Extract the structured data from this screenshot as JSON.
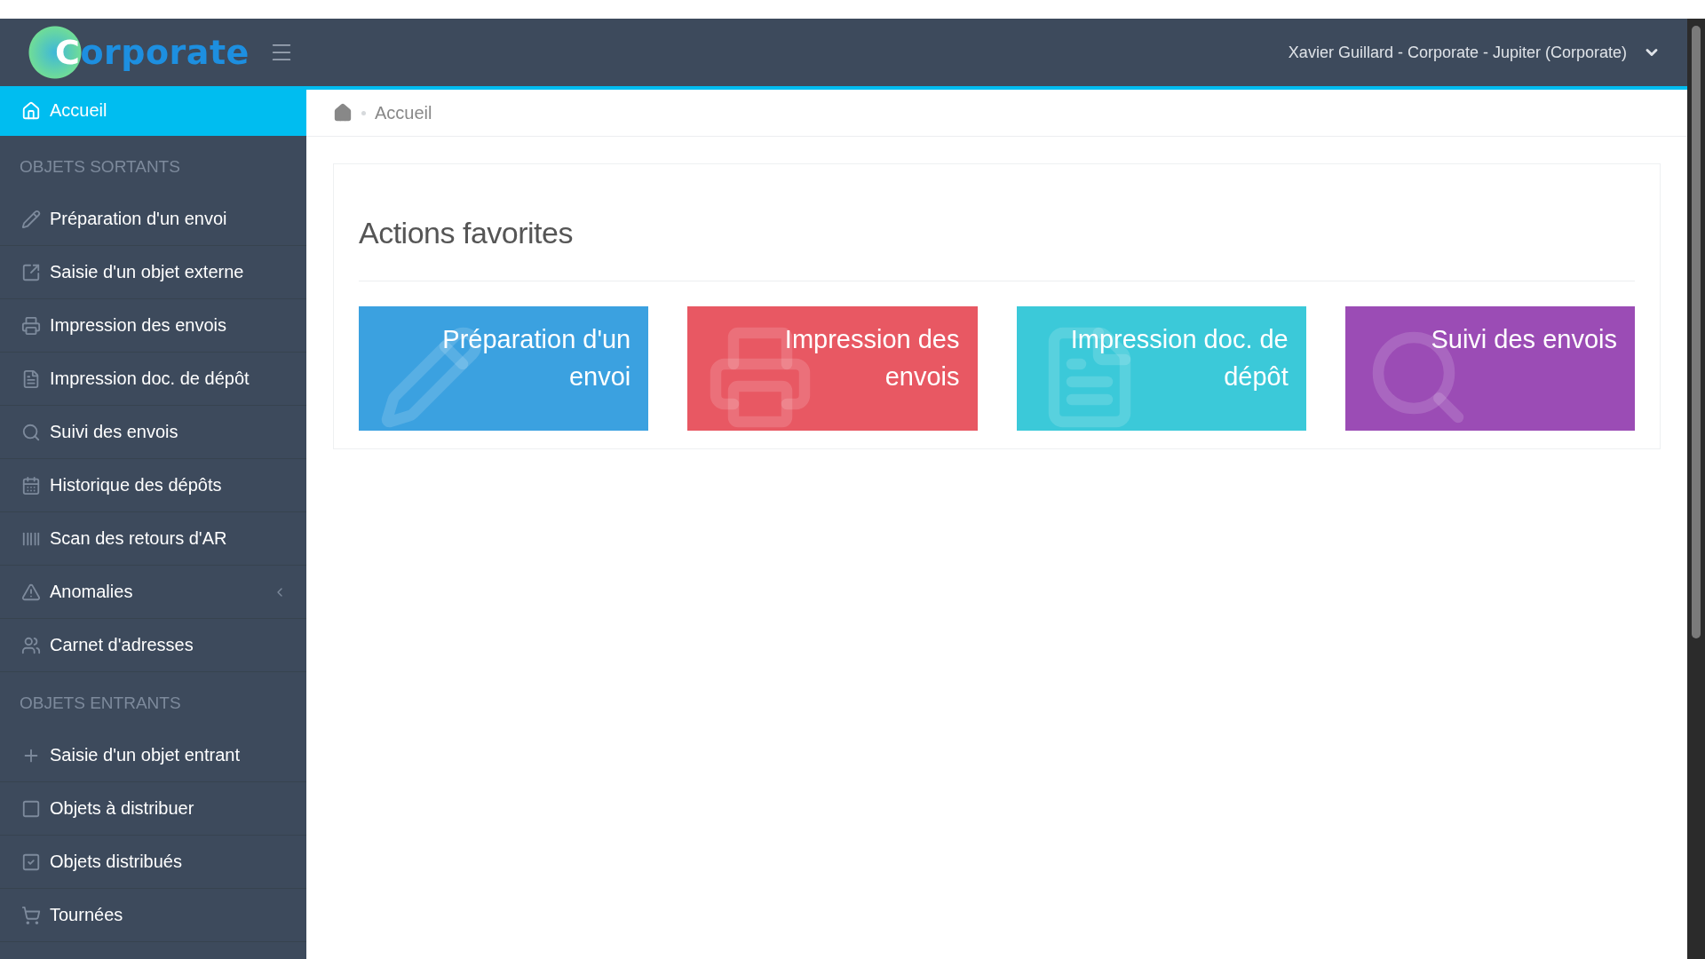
{
  "header": {
    "logo": "Corporate",
    "user": "Xavier Guillard - Corporate - Jupiter (Corporate)"
  },
  "sidebar": {
    "items": [
      {
        "kind": "link",
        "label": "Accueil",
        "selected": true
      },
      {
        "kind": "header",
        "label": "OBJETS SORTANTS"
      },
      {
        "kind": "link",
        "label": "Préparation d'un envoi",
        "selected": false
      },
      {
        "kind": "link",
        "label": "Saisie d'un objet externe",
        "selected": false
      },
      {
        "kind": "link",
        "label": "Impression des envois",
        "selected": false
      },
      {
        "kind": "link",
        "label": "Impression doc. de dépôt",
        "selected": false
      },
      {
        "kind": "link",
        "label": "Suivi des envois",
        "selected": false
      },
      {
        "kind": "link",
        "label": "Historique des dépôts",
        "selected": false
      },
      {
        "kind": "link",
        "label": "Scan des retours d'AR",
        "selected": false
      },
      {
        "kind": "link",
        "label": "Anomalies",
        "selected": false,
        "expanded": false
      },
      {
        "kind": "link",
        "label": "Carnet d'adresses",
        "selected": false
      },
      {
        "kind": "header",
        "label": "OBJETS ENTRANTS"
      },
      {
        "kind": "link",
        "label": "Saisie d'un objet entrant",
        "selected": false
      },
      {
        "kind": "link",
        "label": "Objets à distribuer",
        "selected": false
      },
      {
        "kind": "link",
        "label": "Objets distribués",
        "selected": false
      },
      {
        "kind": "link",
        "label": "Tournées",
        "selected": false
      }
    ]
  },
  "breadcrumb": [
    "Accueil"
  ],
  "panel": {
    "title": "Actions favorites",
    "tiles": [
      {
        "label": "Préparation d'un envoi",
        "color": "#3ba1e0"
      },
      {
        "label": "Impression des envois",
        "color": "#e85863"
      },
      {
        "label": "Impression doc. de dépôt",
        "color": "#3bc9d9"
      },
      {
        "label": "Suivi des envois",
        "color": "#9b4cb5"
      }
    ]
  }
}
